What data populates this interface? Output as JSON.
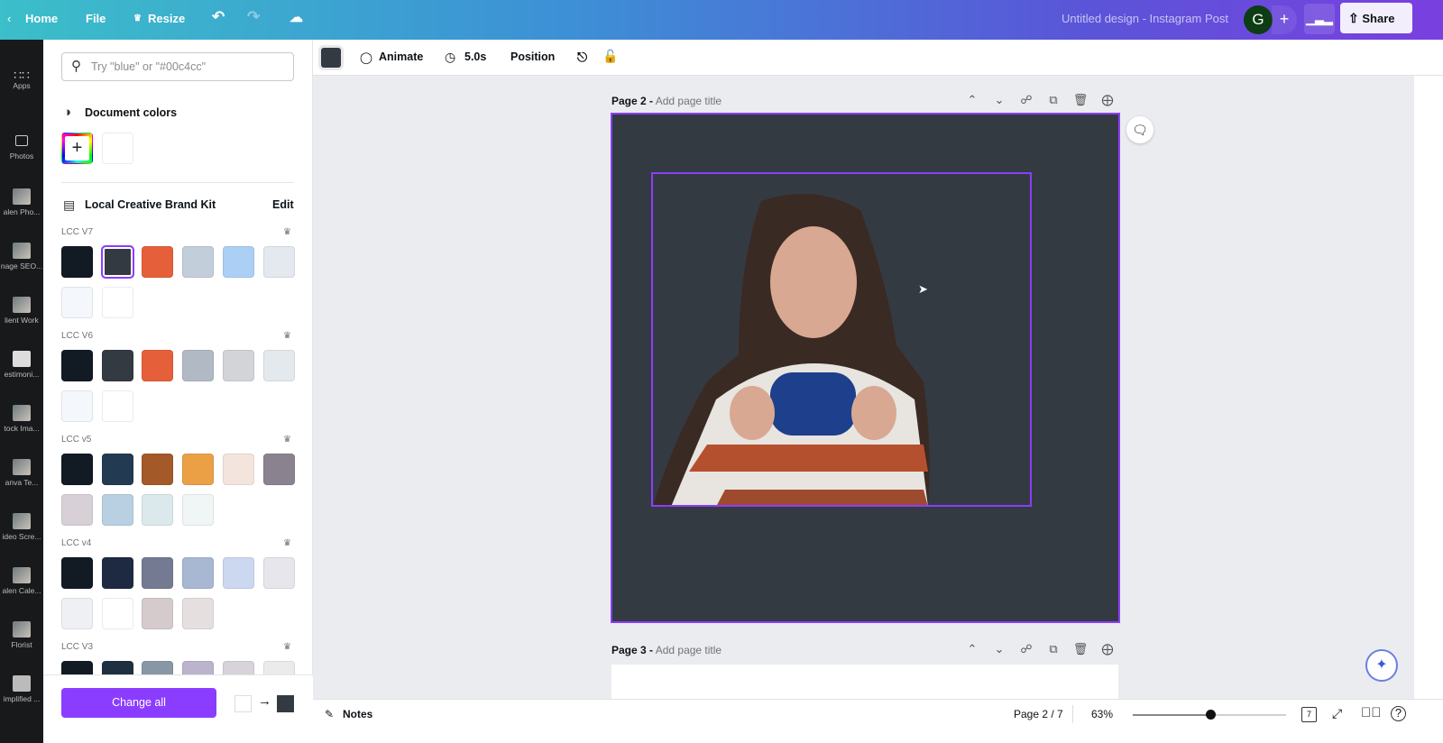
{
  "topbar": {
    "home": "Home",
    "file": "File",
    "resize": "Resize",
    "title": "Untitled design - Instagram Post",
    "avatar_initial": "G",
    "share": "Share",
    "brand_gradient": [
      "#3bbfc9",
      "#7a3fe0"
    ]
  },
  "rail": {
    "items": [
      {
        "label": "Apps",
        "icon": "grid-icon"
      },
      {
        "label": "Photos",
        "icon": "photo-icon"
      },
      {
        "label": "alen Pho..."
      },
      {
        "label": "nage SEO..."
      },
      {
        "label": "lient Work"
      },
      {
        "label": "estimoni..."
      },
      {
        "label": "tock Ima..."
      },
      {
        "label": "anva Te..."
      },
      {
        "label": "ideo Scre..."
      },
      {
        "label": "alen Cale..."
      },
      {
        "label": "Florist"
      },
      {
        "label": "implified ..."
      }
    ]
  },
  "panel": {
    "search_placeholder": "Try \"blue\" or \"#00c4cc\"",
    "document_colors": "Document colors",
    "document_swatches": [
      "#ffffff"
    ],
    "brand_kit": "Local Creative Brand Kit",
    "edit": "Edit",
    "palettes": [
      {
        "name": "LCC V7",
        "colors": [
          "#121a23",
          "#343a42",
          "#e5603a",
          "#c3cedb",
          "#acd0f5",
          "#e4e9ef",
          "#f4f7fb",
          "#ffffff"
        ],
        "selected": 1
      },
      {
        "name": "LCC V6",
        "colors": [
          "#121a23",
          "#343a42",
          "#e5603a",
          "#b0b9c4",
          "#d2d4d8",
          "#e4e9ee",
          "#f4f7fb",
          "#ffffff"
        ]
      },
      {
        "name": "LCC v5",
        "colors": [
          "#121b23",
          "#233b52",
          "#a35a28",
          "#eba046",
          "#f3e4dd",
          "#8b828f",
          "#d7d1d7",
          "#b8d0e2",
          "#dbe9ec",
          "#f0f6f6"
        ]
      },
      {
        "name": "LCC v4",
        "colors": [
          "#121b23",
          "#1e2a42",
          "#737a92",
          "#a8b8d2",
          "#ccd7f0",
          "#e6e6ec",
          "#eff0f4",
          "#ffffff",
          "#d5cbcd",
          "#e5dfe0"
        ]
      },
      {
        "name": "LCC V3",
        "colors": [
          "#121b23",
          "#1f3040",
          "#8897a5",
          "#bcb3cc",
          "#d8d3db",
          "#ebebeb"
        ]
      }
    ],
    "change_all": "Change all",
    "replace_from": "#ffffff",
    "replace_to": "#343a42"
  },
  "toolbar": {
    "color": "#343a42",
    "animate": "Animate",
    "duration": "5.0s",
    "position": "Position"
  },
  "pages": [
    {
      "label": "Page 2 -",
      "title_placeholder": "Add page title",
      "background": "#343a42"
    },
    {
      "label": "Page 3 -",
      "title_placeholder": "Add page title"
    }
  ],
  "selection_color": "#8b3dff",
  "bottombar": {
    "notes": "Notes",
    "page_indicator": "Page 2 / 7",
    "zoom": "63%",
    "zoom_value": 63,
    "page_count": "7"
  }
}
